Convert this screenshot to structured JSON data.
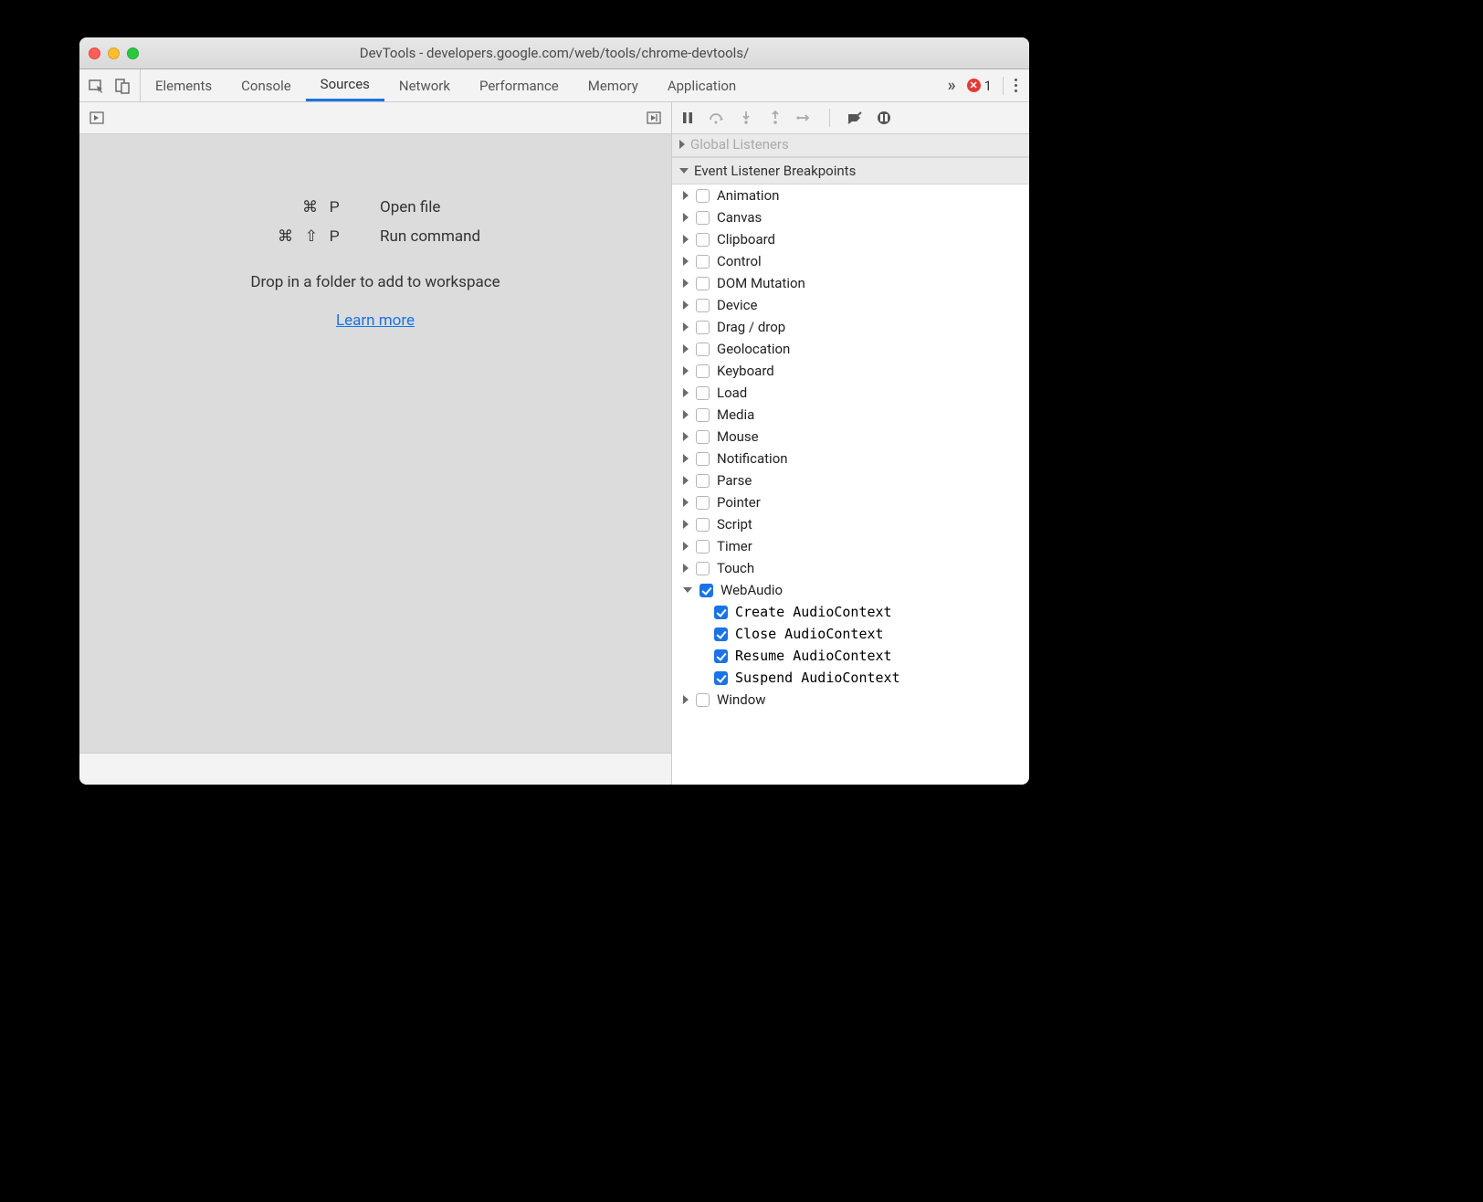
{
  "title": "DevTools - developers.google.com/web/tools/chrome-devtools/",
  "tabs": [
    "Elements",
    "Console",
    "Sources",
    "Network",
    "Performance",
    "Memory",
    "Application"
  ],
  "activeTab": "Sources",
  "errorCount": "1",
  "shortcuts": {
    "openFile": {
      "keys": "⌘ P",
      "label": "Open file"
    },
    "runCommand": {
      "keys": "⌘ ⇧ P",
      "label": "Run command"
    }
  },
  "dropzone": {
    "message": "Drop in a folder to add to workspace",
    "learn": "Learn more"
  },
  "rightPanes": {
    "cutoff": "Global Listeners",
    "header": "Event Listener Breakpoints",
    "categories": [
      "Animation",
      "Canvas",
      "Clipboard",
      "Control",
      "DOM Mutation",
      "Device",
      "Drag / drop",
      "Geolocation",
      "Keyboard",
      "Load",
      "Media",
      "Mouse",
      "Notification",
      "Parse",
      "Pointer",
      "Script",
      "Timer",
      "Touch"
    ],
    "webaudio": {
      "label": "WebAudio",
      "children": [
        "Create AudioContext",
        "Close AudioContext",
        "Resume AudioContext",
        "Suspend AudioContext"
      ]
    },
    "windowCat": "Window"
  }
}
